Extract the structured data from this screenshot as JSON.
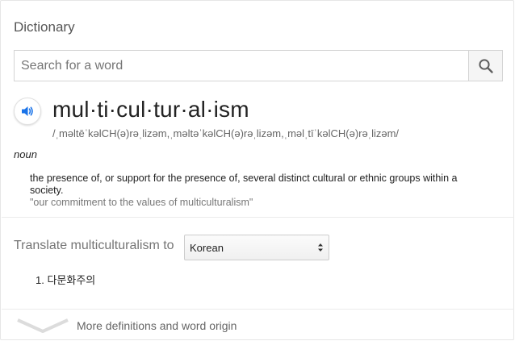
{
  "header": {
    "title": "Dictionary"
  },
  "search": {
    "placeholder": "Search for a word",
    "value": ""
  },
  "entry": {
    "headword": "mul·ti·cul·tur·al·ism",
    "pronunciation": "/ˌməltēˈkəlCH(ə)rəˌlizəm,ˌməltəˈkəlCH(ə)rəˌlizəm,ˌməlˌtīˈkəlCH(ə)rəˌlizəm/",
    "part_of_speech": "noun",
    "definition": "the presence of, or support for the presence of, several distinct cultural or ethnic groups within a society.",
    "example": "\"our commitment to the values of multiculturalism\""
  },
  "translate": {
    "label": "Translate multiculturalism to",
    "selected_language": "Korean",
    "results": [
      {
        "number": "1.",
        "text": "다문화주의"
      }
    ]
  },
  "footer": {
    "more_label": "More definitions and word origin"
  },
  "icons": {
    "search": "search-icon",
    "speaker": "speaker-icon",
    "select_arrows": "select-arrows-icon",
    "expand": "chevron-down-icon"
  },
  "colors": {
    "speaker_accent": "#1a73e8",
    "divider": "#ebebeb"
  }
}
